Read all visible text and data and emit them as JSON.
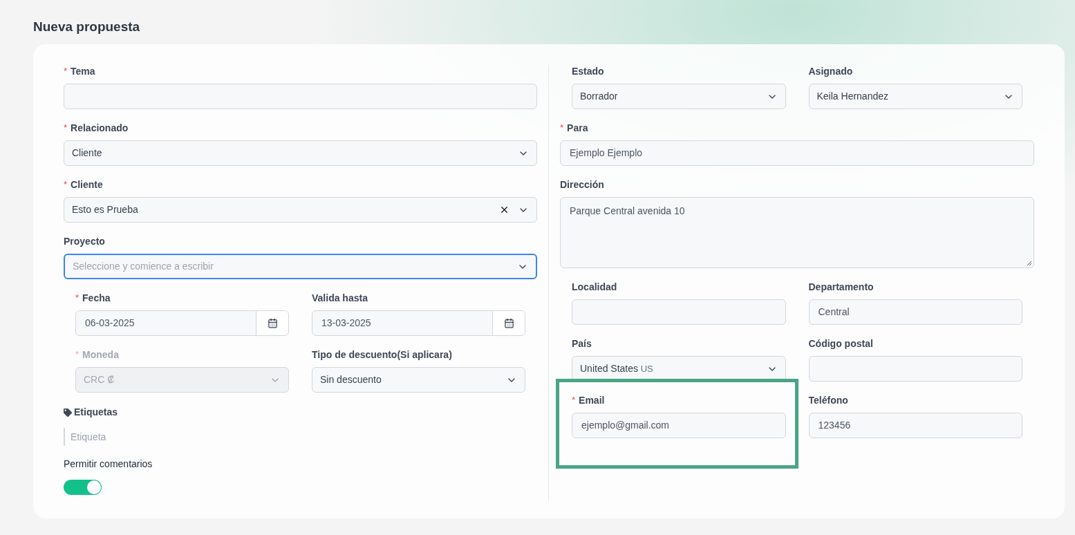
{
  "title": "Nueva propuesta",
  "left": {
    "fields": [
      {
        "label": "Tema",
        "mark": "*",
        "kind": "text"
      },
      {
        "label": "Relacionado",
        "mark": "*",
        "kind": "select",
        "value": "Cliente"
      },
      {
        "label": "Cliente",
        "mark": "*",
        "kind": "select",
        "value": "Esto es Prueba",
        "clearable": true
      },
      {
        "label": "Proyecto",
        "kind": "select",
        "placeholder": "Seleccione y comience a escribir",
        "focused": true
      }
    ],
    "grid": [
      {
        "label": "Fecha",
        "mark": "*",
        "kind": "date",
        "value": "06-03-2025"
      },
      {
        "label": "Valida hasta",
        "kind": "date",
        "value": "13-03-2025"
      },
      {
        "label": "Moneda",
        "mark": "*",
        "kind": "select",
        "value": "CRC ₡",
        "disabled": true
      },
      {
        "label": "Tipo de descuento(Si aplicara)",
        "kind": "select",
        "value": "Sin descuento"
      }
    ],
    "tags": {
      "label": "Etiquetas",
      "placeholder": "Etiqueta"
    },
    "toggle": {
      "label": "Permitir comentarios",
      "on": true
    }
  },
  "right": {
    "top": [
      {
        "label": "Estado",
        "kind": "select",
        "value": "Borrador"
      },
      {
        "label": "Asignado",
        "kind": "select",
        "value": "Keila Hernandez"
      }
    ],
    "fields": [
      {
        "label": "Para",
        "mark": "*",
        "kind": "text",
        "value": "Ejemplo Ejemplo"
      },
      {
        "label": "Dirección",
        "kind": "textarea",
        "value": "Parque Central avenida 10"
      }
    ],
    "grid": [
      {
        "label": "Localidad",
        "kind": "text"
      },
      {
        "label": "Departamento",
        "kind": "text",
        "value": "Central"
      },
      {
        "label": "País",
        "kind": "select",
        "value": "United States",
        "suffix": "US"
      },
      {
        "label": "Código postal",
        "kind": "text"
      },
      {
        "label": "Email",
        "mark": "*",
        "kind": "text",
        "value": "ejemplo@gmail.com",
        "highlighted": true
      },
      {
        "label": "Teléfono",
        "kind": "text",
        "value": "123456"
      }
    ]
  }
}
